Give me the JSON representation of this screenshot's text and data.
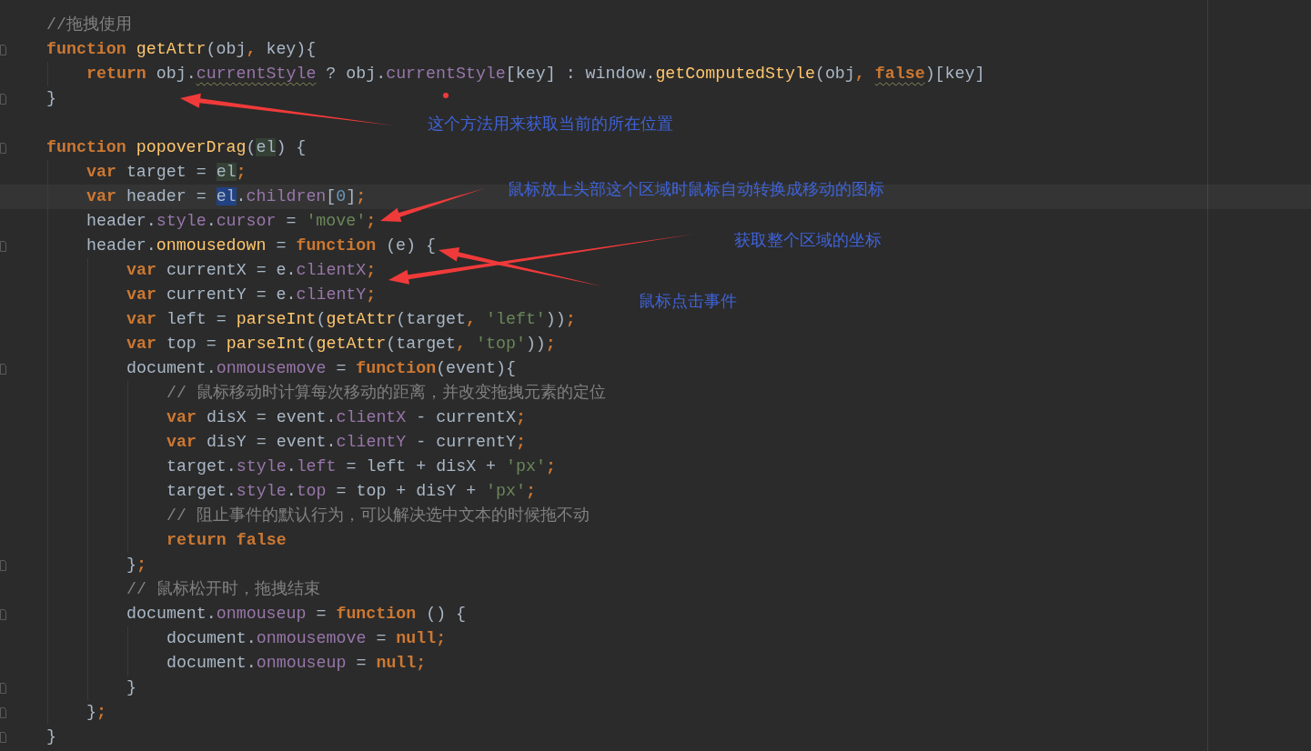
{
  "editor": {
    "lines": [
      {
        "kind": "code",
        "tokens": [
          {
            "kind": "cmt",
            "t": "//拖拽使用"
          }
        ]
      },
      {
        "kind": "code",
        "fold": true,
        "tokens": [
          {
            "kind": "kw",
            "t": "function"
          },
          {
            "kind": "fn",
            "t": "getAttr",
            "gap": true
          },
          {
            "kind": "txt",
            "t": "(obj"
          },
          {
            "kind": "op",
            "t": ","
          },
          {
            "kind": "txt",
            "t": "key){",
            "gap": true
          }
        ],
        "children": [
          {
            "kind": "code",
            "tokens": [
              {
                "kind": "kw",
                "t": "return"
              },
              {
                "kind": "txt",
                "t": "obj.",
                "gap": true
              },
              {
                "kind": "prop",
                "t": "currentStyle",
                "warning": true
              },
              {
                "kind": "txt",
                "t": " ? obj."
              },
              {
                "kind": "prop",
                "t": "currentStyle"
              },
              {
                "kind": "txt",
                "t": "[key] : window."
              },
              {
                "kind": "fn",
                "t": "getComputedStyle"
              },
              {
                "kind": "txt",
                "t": "(obj"
              },
              {
                "kind": "op",
                "t": ","
              },
              {
                "kind": "kw",
                "t": "false",
                "warning": true,
                "gap": true
              },
              {
                "kind": "txt",
                "t": ")[key]"
              }
            ]
          }
        ]
      },
      {
        "kind": "code",
        "fold": true,
        "tokens": [
          {
            "kind": "txt",
            "t": "}"
          }
        ]
      },
      {
        "kind": "blank"
      },
      {
        "kind": "code",
        "fold": true,
        "tokens": [
          {
            "kind": "kw",
            "t": "function"
          },
          {
            "kind": "fn",
            "t": "popoverDrag",
            "gap": true
          },
          {
            "kind": "txt",
            "t": "("
          },
          {
            "kind": "txt",
            "t": "el",
            "highlighted": true
          },
          {
            "kind": "txt",
            "t": ") {"
          }
        ],
        "children": [
          {
            "kind": "code",
            "tokens": [
              {
                "kind": "kw",
                "t": "var"
              },
              {
                "kind": "txt",
                "t": " target = "
              },
              {
                "kind": "txt",
                "t": "el",
                "highlighted": true
              },
              {
                "kind": "op",
                "t": ";"
              }
            ]
          },
          {
            "kind": "code",
            "current": true,
            "tokens": [
              {
                "kind": "kw",
                "t": "var"
              },
              {
                "kind": "txt",
                "t": " header = "
              },
              {
                "kind": "txt",
                "t": "el",
                "selected": true
              },
              {
                "kind": "txt",
                "t": "."
              },
              {
                "kind": "prop",
                "t": "children"
              },
              {
                "kind": "txt",
                "t": "["
              },
              {
                "kind": "num",
                "t": "0"
              },
              {
                "kind": "txt",
                "t": "]"
              },
              {
                "kind": "op",
                "t": ";"
              }
            ]
          },
          {
            "kind": "code",
            "tokens": [
              {
                "kind": "txt",
                "t": "header."
              },
              {
                "kind": "prop",
                "t": "style"
              },
              {
                "kind": "txt",
                "t": "."
              },
              {
                "kind": "prop",
                "t": "cursor"
              },
              {
                "kind": "txt",
                "t": " = "
              },
              {
                "kind": "str",
                "t": "'move'"
              },
              {
                "kind": "op",
                "t": ";"
              }
            ]
          },
          {
            "kind": "code",
            "fold": true,
            "tokens": [
              {
                "kind": "txt",
                "t": "header."
              },
              {
                "kind": "fn",
                "t": "onmousedown"
              },
              {
                "kind": "txt",
                "t": " = "
              },
              {
                "kind": "kw",
                "t": "function"
              },
              {
                "kind": "txt",
                "t": " (e) {"
              }
            ],
            "children": [
              {
                "kind": "code",
                "tokens": [
                  {
                    "kind": "kw",
                    "t": "var"
                  },
                  {
                    "kind": "txt",
                    "t": " currentX = e."
                  },
                  {
                    "kind": "prop",
                    "t": "clientX"
                  },
                  {
                    "kind": "op",
                    "t": ";"
                  }
                ]
              },
              {
                "kind": "code",
                "tokens": [
                  {
                    "kind": "kw",
                    "t": "var"
                  },
                  {
                    "kind": "txt",
                    "t": " currentY = e."
                  },
                  {
                    "kind": "prop",
                    "t": "clientY"
                  },
                  {
                    "kind": "op",
                    "t": ";"
                  }
                ]
              },
              {
                "kind": "code",
                "tokens": [
                  {
                    "kind": "kw",
                    "t": "var"
                  },
                  {
                    "kind": "txt",
                    "t": " left = "
                  },
                  {
                    "kind": "fn",
                    "t": "parseInt"
                  },
                  {
                    "kind": "txt",
                    "t": "("
                  },
                  {
                    "kind": "fn",
                    "t": "getAttr"
                  },
                  {
                    "kind": "txt",
                    "t": "(target"
                  },
                  {
                    "kind": "op",
                    "t": ","
                  },
                  {
                    "kind": "str",
                    "t": "'left'",
                    "gap": true
                  },
                  {
                    "kind": "txt",
                    "t": "))"
                  },
                  {
                    "kind": "op",
                    "t": ";"
                  }
                ]
              },
              {
                "kind": "code",
                "tokens": [
                  {
                    "kind": "kw",
                    "t": "var"
                  },
                  {
                    "kind": "txt",
                    "t": " top = "
                  },
                  {
                    "kind": "fn",
                    "t": "parseInt"
                  },
                  {
                    "kind": "txt",
                    "t": "("
                  },
                  {
                    "kind": "fn",
                    "t": "getAttr"
                  },
                  {
                    "kind": "txt",
                    "t": "(target"
                  },
                  {
                    "kind": "op",
                    "t": ","
                  },
                  {
                    "kind": "str",
                    "t": "'top'",
                    "gap": true
                  },
                  {
                    "kind": "txt",
                    "t": "))"
                  },
                  {
                    "kind": "op",
                    "t": ";"
                  }
                ]
              },
              {
                "kind": "code",
                "fold": true,
                "tokens": [
                  {
                    "kind": "txt",
                    "t": "document."
                  },
                  {
                    "kind": "prop",
                    "t": "onmousemove"
                  },
                  {
                    "kind": "txt",
                    "t": " = "
                  },
                  {
                    "kind": "kw",
                    "t": "function"
                  },
                  {
                    "kind": "txt",
                    "t": "(event){"
                  }
                ],
                "children": [
                  {
                    "kind": "code",
                    "tokens": [
                      {
                        "kind": "cmt",
                        "t": "// 鼠标移动时计算每次移动的距离，并改变拖拽元素的定位"
                      }
                    ]
                  },
                  {
                    "kind": "code",
                    "tokens": [
                      {
                        "kind": "kw",
                        "t": "var"
                      },
                      {
                        "kind": "txt",
                        "t": " disX = event."
                      },
                      {
                        "kind": "prop",
                        "t": "clientX"
                      },
                      {
                        "kind": "txt",
                        "t": " - currentX"
                      },
                      {
                        "kind": "op",
                        "t": ";"
                      }
                    ]
                  },
                  {
                    "kind": "code",
                    "tokens": [
                      {
                        "kind": "kw",
                        "t": "var"
                      },
                      {
                        "kind": "txt",
                        "t": " disY = event."
                      },
                      {
                        "kind": "prop",
                        "t": "clientY"
                      },
                      {
                        "kind": "txt",
                        "t": " - currentY"
                      },
                      {
                        "kind": "op",
                        "t": ";"
                      }
                    ]
                  },
                  {
                    "kind": "code",
                    "tokens": [
                      {
                        "kind": "txt",
                        "t": "target."
                      },
                      {
                        "kind": "prop",
                        "t": "style"
                      },
                      {
                        "kind": "txt",
                        "t": "."
                      },
                      {
                        "kind": "prop",
                        "t": "left"
                      },
                      {
                        "kind": "txt",
                        "t": " = left + disX + "
                      },
                      {
                        "kind": "str",
                        "t": "'px'"
                      },
                      {
                        "kind": "op",
                        "t": ";"
                      }
                    ]
                  },
                  {
                    "kind": "code",
                    "tokens": [
                      {
                        "kind": "txt",
                        "t": "target."
                      },
                      {
                        "kind": "prop",
                        "t": "style"
                      },
                      {
                        "kind": "txt",
                        "t": "."
                      },
                      {
                        "kind": "prop",
                        "t": "top"
                      },
                      {
                        "kind": "txt",
                        "t": " = top + disY + "
                      },
                      {
                        "kind": "str",
                        "t": "'px'"
                      },
                      {
                        "kind": "op",
                        "t": ";"
                      }
                    ]
                  },
                  {
                    "kind": "code",
                    "tokens": [
                      {
                        "kind": "cmt",
                        "t": "// 阻止事件的默认行为，可以解决选中文本的时候拖不动"
                      }
                    ]
                  },
                  {
                    "kind": "code",
                    "tokens": [
                      {
                        "kind": "kw",
                        "t": "return"
                      },
                      {
                        "kind": "kw",
                        "t": "false",
                        "gap": true
                      }
                    ]
                  }
                ]
              },
              {
                "kind": "code",
                "fold": true,
                "tokens": [
                  {
                    "kind": "txt",
                    "t": "}"
                  },
                  {
                    "kind": "op",
                    "t": ";"
                  }
                ]
              },
              {
                "kind": "code",
                "tokens": [
                  {
                    "kind": "cmt",
                    "t": "// 鼠标松开时，拖拽结束"
                  }
                ]
              },
              {
                "kind": "code",
                "fold": true,
                "tokens": [
                  {
                    "kind": "txt",
                    "t": "document."
                  },
                  {
                    "kind": "prop",
                    "t": "onmouseup"
                  },
                  {
                    "kind": "txt",
                    "t": " = "
                  },
                  {
                    "kind": "kw",
                    "t": "function"
                  },
                  {
                    "kind": "txt",
                    "t": " () {"
                  }
                ],
                "children": [
                  {
                    "kind": "code",
                    "tokens": [
                      {
                        "kind": "txt",
                        "t": "document."
                      },
                      {
                        "kind": "prop",
                        "t": "onmousemove"
                      },
                      {
                        "kind": "txt",
                        "t": " = "
                      },
                      {
                        "kind": "kw",
                        "t": "null"
                      },
                      {
                        "kind": "op",
                        "t": ";"
                      }
                    ]
                  },
                  {
                    "kind": "code",
                    "tokens": [
                      {
                        "kind": "txt",
                        "t": "document."
                      },
                      {
                        "kind": "prop",
                        "t": "onmouseup"
                      },
                      {
                        "kind": "txt",
                        "t": " = "
                      },
                      {
                        "kind": "kw",
                        "t": "null"
                      },
                      {
                        "kind": "op",
                        "t": ";"
                      }
                    ]
                  }
                ]
              },
              {
                "kind": "code",
                "fold": true,
                "tokens": [
                  {
                    "kind": "txt",
                    "t": "}"
                  }
                ]
              }
            ]
          },
          {
            "kind": "code",
            "fold": true,
            "tokens": [
              {
                "kind": "txt",
                "t": "}"
              },
              {
                "kind": "op",
                "t": ";"
              }
            ]
          }
        ]
      },
      {
        "kind": "code",
        "fold": true,
        "tokens": [
          {
            "kind": "txt",
            "t": "}"
          }
        ]
      }
    ]
  },
  "annotations": [
    {
      "text": "这个方法用来获取当前的所在位置"
    },
    {
      "text": "鼠标放上头部这个区域时鼠标自动转换成移动的图标"
    },
    {
      "text": "获取整个区域的坐标"
    },
    {
      "text": "鼠标点击事件"
    }
  ]
}
